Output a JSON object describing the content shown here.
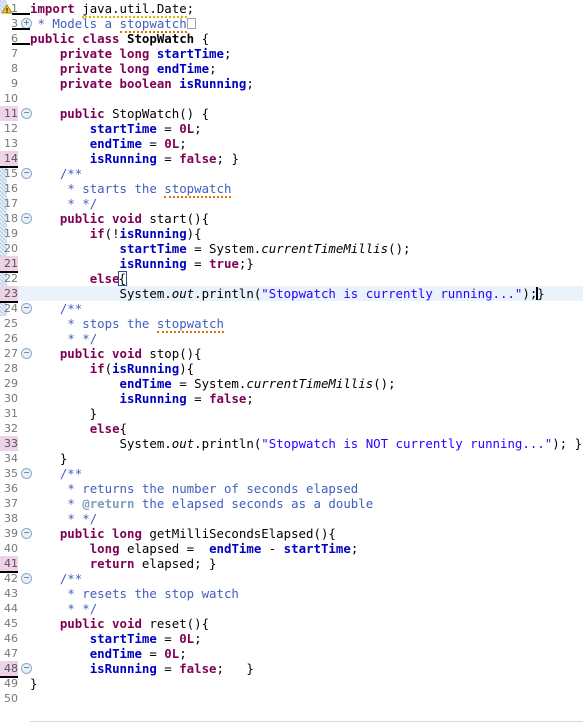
{
  "editor": {
    "language": "java",
    "file_class": "StopWatch",
    "font_size_px": 12.4,
    "line_height_px": 15,
    "colors": {
      "background": "#ffffff",
      "keyword": "#7f0055",
      "field": "#0000c0",
      "comment": "#3f5fbf",
      "javadoc_tag": "#7f9fbf",
      "string": "#2a00ff",
      "line_number": "#787878",
      "current_line_highlight": "#eaf2fc",
      "occurrence_highlight": "#eed3e8",
      "change_bar": "#b8d0ea",
      "spell_squiggle": "#e07000",
      "warning_squiggle": "#d8bb00"
    },
    "gutter": {
      "warning_icon": "warning-icon",
      "fold_expand_glyph": "+",
      "fold_collapse_glyph": "−"
    },
    "cursor_line": 23,
    "highlighted_line_numbers": [
      11,
      14,
      21,
      23,
      41,
      48
    ],
    "change_bar_lines": [
      15,
      16,
      17,
      18,
      19,
      20,
      21,
      22,
      23,
      24
    ],
    "lines": [
      {
        "n": 1,
        "fold": null,
        "warn": true,
        "text": "import java.util.Date;"
      },
      {
        "n": 3,
        "fold": "+",
        "warn": false,
        "text": " * Models a stopwatch"
      },
      {
        "n": 6,
        "fold": null,
        "warn": false,
        "text": "public class StopWatch {"
      },
      {
        "n": 7,
        "fold": null,
        "warn": false,
        "text": "    private long startTime;"
      },
      {
        "n": 8,
        "fold": null,
        "warn": false,
        "text": "    private long endTime;"
      },
      {
        "n": 9,
        "fold": null,
        "warn": false,
        "text": "    private boolean isRunning;"
      },
      {
        "n": 10,
        "fold": null,
        "warn": false,
        "text": ""
      },
      {
        "n": 11,
        "fold": "−",
        "warn": false,
        "text": "    public StopWatch() {"
      },
      {
        "n": 12,
        "fold": null,
        "warn": false,
        "text": "        startTime = 0L;"
      },
      {
        "n": 13,
        "fold": null,
        "warn": false,
        "text": "        endTime = 0L;"
      },
      {
        "n": 14,
        "fold": null,
        "warn": false,
        "text": "        isRunning = false; }"
      },
      {
        "n": 15,
        "fold": "−",
        "warn": false,
        "text": "    /**"
      },
      {
        "n": 16,
        "fold": null,
        "warn": false,
        "text": "     * starts the stopwatch"
      },
      {
        "n": 17,
        "fold": null,
        "warn": false,
        "text": "     * */"
      },
      {
        "n": 18,
        "fold": "−",
        "warn": false,
        "text": "    public void start(){"
      },
      {
        "n": 19,
        "fold": null,
        "warn": false,
        "text": "        if(!isRunning){"
      },
      {
        "n": 20,
        "fold": null,
        "warn": false,
        "text": "            startTime = System.currentTimeMillis();"
      },
      {
        "n": 21,
        "fold": null,
        "warn": false,
        "text": "            isRunning = true;}"
      },
      {
        "n": 22,
        "fold": null,
        "warn": false,
        "text": "        else{"
      },
      {
        "n": 23,
        "fold": null,
        "warn": false,
        "text": "            System.out.println(\"Stopwatch is currently running...\"); }      }"
      },
      {
        "n": 24,
        "fold": "−",
        "warn": false,
        "text": "    /**"
      },
      {
        "n": 25,
        "fold": null,
        "warn": false,
        "text": "     * stops the stopwatch"
      },
      {
        "n": 26,
        "fold": null,
        "warn": false,
        "text": "     * */"
      },
      {
        "n": 27,
        "fold": "−",
        "warn": false,
        "text": "    public void stop(){"
      },
      {
        "n": 28,
        "fold": null,
        "warn": false,
        "text": "        if(isRunning){"
      },
      {
        "n": 29,
        "fold": null,
        "warn": false,
        "text": "            endTime = System.currentTimeMillis();"
      },
      {
        "n": 30,
        "fold": null,
        "warn": false,
        "text": "            isRunning = false;"
      },
      {
        "n": 31,
        "fold": null,
        "warn": false,
        "text": "        }"
      },
      {
        "n": 32,
        "fold": null,
        "warn": false,
        "text": "        else{"
      },
      {
        "n": 33,
        "fold": null,
        "warn": false,
        "text": "            System.out.println(\"Stopwatch is NOT currently running...\"); }"
      },
      {
        "n": 34,
        "fold": null,
        "warn": false,
        "text": "    }"
      },
      {
        "n": 35,
        "fold": "−",
        "warn": false,
        "text": "    /**"
      },
      {
        "n": 36,
        "fold": null,
        "warn": false,
        "text": "     * returns the number of seconds elapsed"
      },
      {
        "n": 37,
        "fold": null,
        "warn": false,
        "text": "     * @return the elapsed seconds as a double"
      },
      {
        "n": 38,
        "fold": null,
        "warn": false,
        "text": "     * */"
      },
      {
        "n": 39,
        "fold": "−",
        "warn": false,
        "text": "    public long getMilliSecondsElapsed(){"
      },
      {
        "n": 40,
        "fold": null,
        "warn": false,
        "text": "        long elapsed =  endTime - startTime;"
      },
      {
        "n": 41,
        "fold": null,
        "warn": false,
        "text": "        return elapsed; }"
      },
      {
        "n": 42,
        "fold": "−",
        "warn": false,
        "text": "    /**"
      },
      {
        "n": 43,
        "fold": null,
        "warn": false,
        "text": "     * resets the stop watch"
      },
      {
        "n": 44,
        "fold": null,
        "warn": false,
        "text": "     * */"
      },
      {
        "n": 45,
        "fold": "−",
        "warn": false,
        "text": "    public void reset(){"
      },
      {
        "n": 46,
        "fold": null,
        "warn": false,
        "text": "        startTime = 0L;"
      },
      {
        "n": 47,
        "fold": null,
        "warn": false,
        "text": "        endTime = 0L;"
      },
      {
        "n": 48,
        "fold": null,
        "warn": false,
        "text": "        isRunning = false;   }"
      },
      {
        "n": 49,
        "fold": null,
        "warn": false,
        "text": "}"
      },
      {
        "n": 50,
        "fold": null,
        "warn": false,
        "text": ""
      }
    ]
  }
}
